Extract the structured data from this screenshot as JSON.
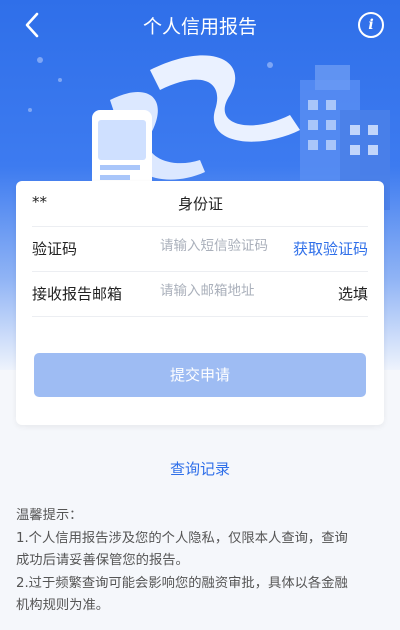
{
  "header": {
    "title": "个人信用报告",
    "back_icon": "chevron-left-icon",
    "info_icon": "info-icon",
    "bg_color": "#2f6fe9"
  },
  "form": {
    "id_row": {
      "label": "**",
      "value": "身份证"
    },
    "code_row": {
      "label": "验证码",
      "placeholder": "请输入短信验证码",
      "action": "获取验证码"
    },
    "email_row": {
      "label": "接收报告邮箱",
      "placeholder": "请输入邮箱地址",
      "option": "选填"
    },
    "submit_label": "提交申请"
  },
  "history_link": "查询记录",
  "tips": {
    "heading": "温馨提示：",
    "line1": "1.个人信用报告涉及您的个人隐私，仅限本人查询，查询",
    "line1b": "成功后请妥善保管您的报告。",
    "line2": "2.过于频繁查询可能会影响您的融资审批，具体以各金融",
    "line2b": "机构规则为准。"
  },
  "colors": {
    "accent": "#2f6fe9",
    "button_disabled": "#9ebcf3"
  }
}
